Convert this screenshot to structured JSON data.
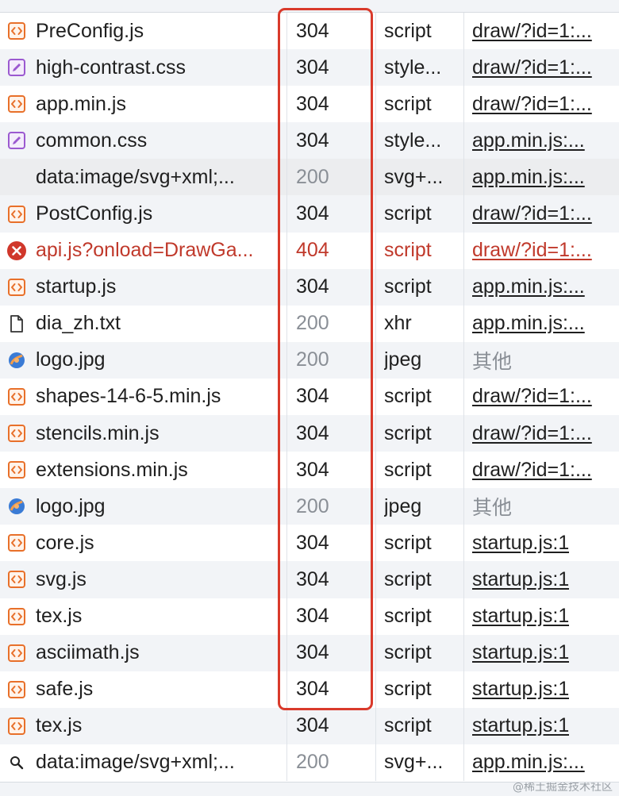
{
  "requests": [
    {
      "name": "PreConfig.js",
      "status": "304",
      "type": "script",
      "initiator": "draw/?id=1:...",
      "icon": "script-icon",
      "kind": "script"
    },
    {
      "name": "high-contrast.css",
      "status": "304",
      "type": "style...",
      "initiator": "draw/?id=1:...",
      "icon": "stylesheet-icon",
      "kind": "css"
    },
    {
      "name": "app.min.js",
      "status": "304",
      "type": "script",
      "initiator": "draw/?id=1:...",
      "icon": "script-icon",
      "kind": "script"
    },
    {
      "name": "common.css",
      "status": "304",
      "type": "style...",
      "initiator": "app.min.js:...",
      "icon": "stylesheet-icon",
      "kind": "css"
    },
    {
      "name": "data:image/svg+xml;...",
      "status": "200",
      "type": "svg+...",
      "initiator": "app.min.js:...",
      "icon": "",
      "kind": "blank"
    },
    {
      "name": "PostConfig.js",
      "status": "304",
      "type": "script",
      "initiator": "draw/?id=1:...",
      "icon": "script-icon",
      "kind": "script"
    },
    {
      "name": "api.js?onload=DrawGa...",
      "status": "404",
      "type": "script",
      "initiator": "draw/?id=1:...",
      "icon": "error-icon",
      "kind": "error"
    },
    {
      "name": "startup.js",
      "status": "304",
      "type": "script",
      "initiator": "app.min.js:...",
      "icon": "script-icon",
      "kind": "script"
    },
    {
      "name": "dia_zh.txt",
      "status": "200",
      "type": "xhr",
      "initiator": "app.min.js:...",
      "icon": "document-icon",
      "kind": "doc"
    },
    {
      "name": "logo.jpg",
      "status": "200",
      "type": "jpeg",
      "initiator": "其他",
      "icon": "image-icon",
      "kind": "image"
    },
    {
      "name": "shapes-14-6-5.min.js",
      "status": "304",
      "type": "script",
      "initiator": "draw/?id=1:...",
      "icon": "script-icon",
      "kind": "script"
    },
    {
      "name": "stencils.min.js",
      "status": "304",
      "type": "script",
      "initiator": "draw/?id=1:...",
      "icon": "script-icon",
      "kind": "script"
    },
    {
      "name": "extensions.min.js",
      "status": "304",
      "type": "script",
      "initiator": "draw/?id=1:...",
      "icon": "script-icon",
      "kind": "script"
    },
    {
      "name": "logo.jpg",
      "status": "200",
      "type": "jpeg",
      "initiator": "其他",
      "icon": "image-icon",
      "kind": "image"
    },
    {
      "name": "core.js",
      "status": "304",
      "type": "script",
      "initiator": "startup.js:1",
      "icon": "script-icon",
      "kind": "script"
    },
    {
      "name": "svg.js",
      "status": "304",
      "type": "script",
      "initiator": "startup.js:1",
      "icon": "script-icon",
      "kind": "script"
    },
    {
      "name": "tex.js",
      "status": "304",
      "type": "script",
      "initiator": "startup.js:1",
      "icon": "script-icon",
      "kind": "script"
    },
    {
      "name": "asciimath.js",
      "status": "304",
      "type": "script",
      "initiator": "startup.js:1",
      "icon": "script-icon",
      "kind": "script"
    },
    {
      "name": "safe.js",
      "status": "304",
      "type": "script",
      "initiator": "startup.js:1",
      "icon": "script-icon",
      "kind": "script"
    },
    {
      "name": "tex.js",
      "status": "304",
      "type": "script",
      "initiator": "startup.js:1",
      "icon": "script-icon",
      "kind": "script"
    },
    {
      "name": "data:image/svg+xml;...",
      "status": "200",
      "type": "svg+...",
      "initiator": "app.min.js:...",
      "icon": "search-icon",
      "kind": "search"
    }
  ],
  "watermark": "@稀土掘金技术社区",
  "colors": {
    "error": "#c0392b",
    "highlight": "#d93a2b",
    "script_icon": "#e8702a",
    "css_icon": "#9b59d0"
  }
}
